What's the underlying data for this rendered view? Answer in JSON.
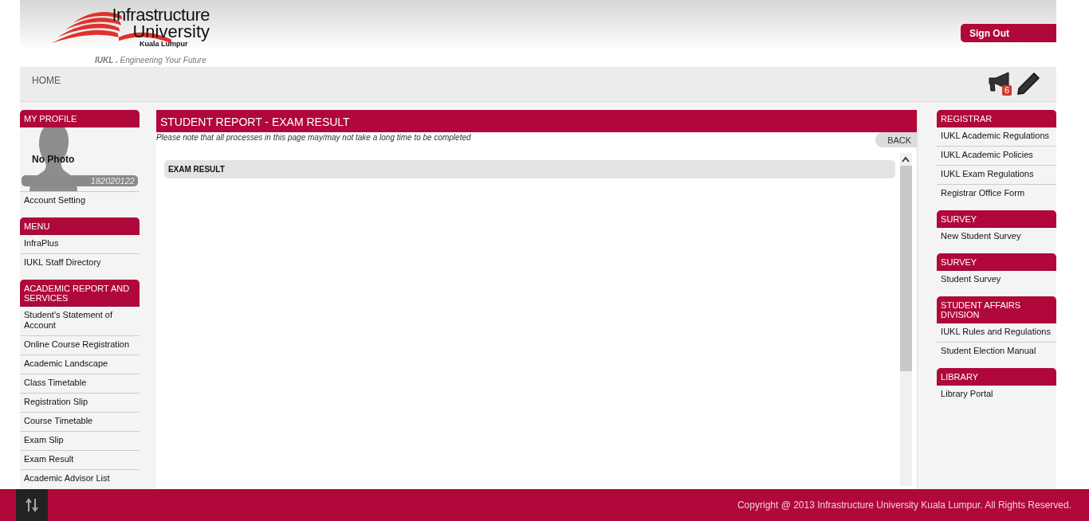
{
  "header": {
    "logo_line1": "Infrastructure",
    "logo_line2": "University",
    "logo_line3": "Kuala Lumpur",
    "tagline": "**IUKL .** Engineering Your Future",
    "sign_out": "Sign Out"
  },
  "nav": {
    "home": "HOME",
    "notification_count": "6"
  },
  "profile": {
    "title": "MY PROFILE",
    "photo_label": "No Photo",
    "student_id": "182020122",
    "items": [
      "Account Setting"
    ]
  },
  "left_sections": [
    {
      "title": "MENU",
      "items": [
        "InfraPlus",
        "IUKL Staff Directory"
      ]
    },
    {
      "title": "ACADEMIC REPORT AND SERVICES",
      "items": [
        "Student's Statement of Account",
        "Online Course Registration",
        "Academic Landscape",
        "Class Timetable",
        "Registration Slip",
        "Course Timetable",
        "Exam Slip",
        "Exam Result",
        "Academic Advisor List"
      ]
    }
  ],
  "main": {
    "title": "STUDENT REPORT - EXAM RESULT",
    "note": "Please note that all processes in this page may/may not take a long time to be completed",
    "back": "BACK",
    "section": "EXAM RESULT"
  },
  "right_sections": [
    {
      "title": "REGISTRAR",
      "items": [
        "IUKL Academic Regulations",
        "IUKL Academic Policies",
        "IUKL Exam Regulations",
        "Registrar Office Form"
      ]
    },
    {
      "title": "SURVEY",
      "items": [
        "New Student Survey"
      ]
    },
    {
      "title": "SURVEY",
      "items": [
        "Student Survey"
      ]
    },
    {
      "title": "STUDENT AFFAIRS DIVISION",
      "items": [
        "IUKL Rules and Regulations",
        "Student Election Manual"
      ]
    },
    {
      "title": "LIBRARY",
      "items": [
        "Library Portal"
      ]
    }
  ],
  "footer": {
    "copyright": "Copyright @ 2013 Infrastructure University Kuala Lumpur. All Rights Reserved."
  }
}
